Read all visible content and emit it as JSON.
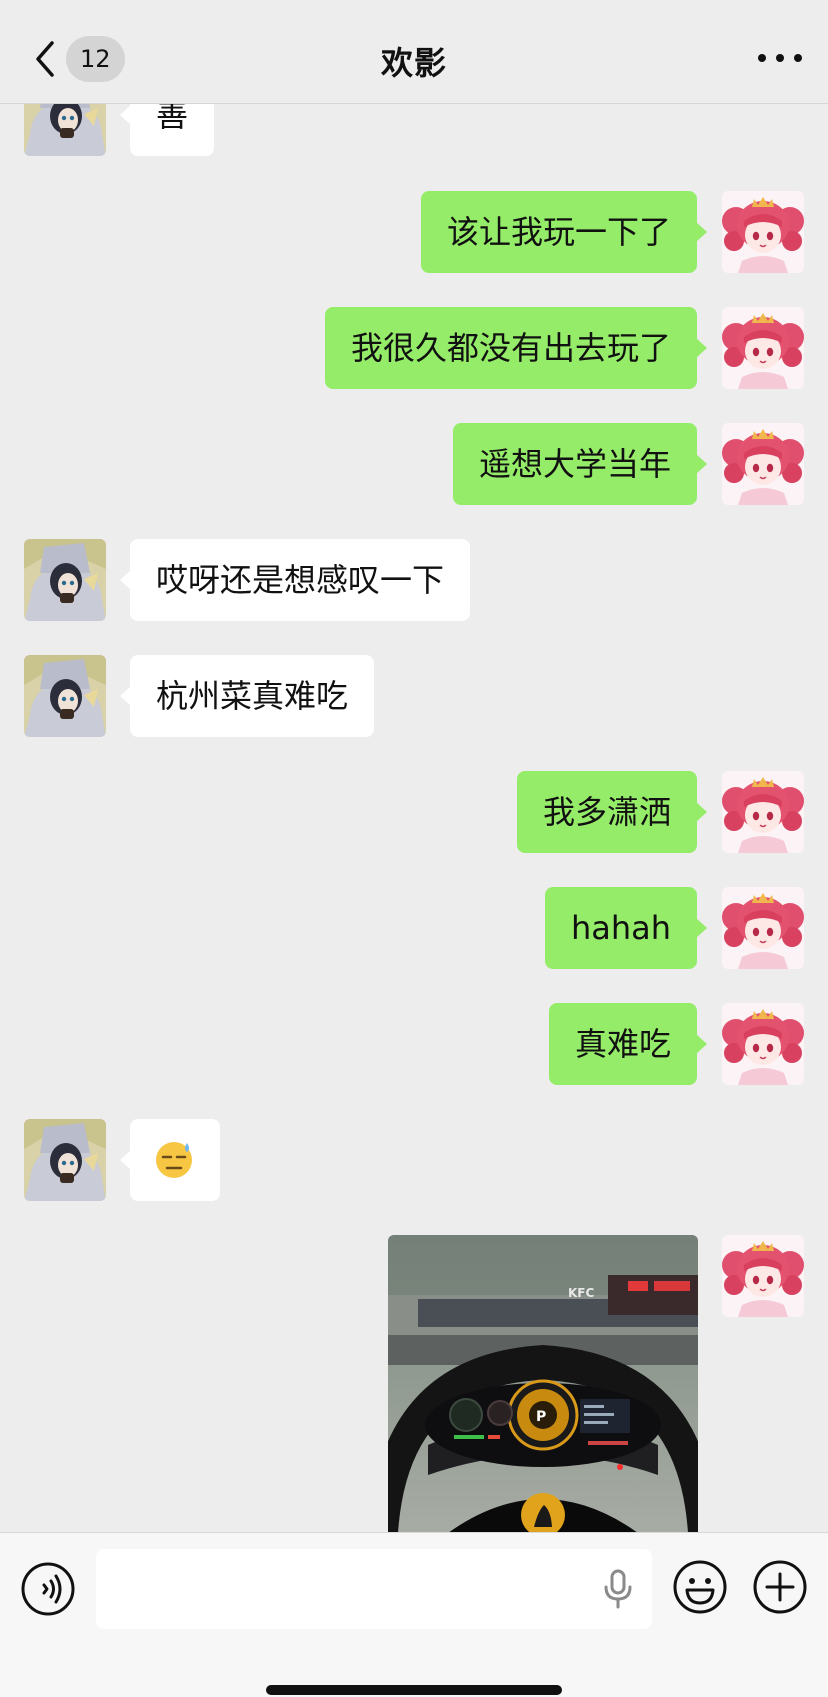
{
  "header": {
    "unread_count": "12",
    "title": "欢影"
  },
  "messages": [
    {
      "side": "in",
      "text": "善"
    },
    {
      "side": "out",
      "text": "该让我玩一下了"
    },
    {
      "side": "out",
      "text": "我很久都没有出去玩了"
    },
    {
      "side": "out",
      "text": "遥想大学当年"
    },
    {
      "side": "in",
      "text": "哎呀还是想感叹一下"
    },
    {
      "side": "in",
      "text": "杭州菜真难吃"
    },
    {
      "side": "out",
      "text": "我多潇洒"
    },
    {
      "side": "out",
      "text": "hahah"
    },
    {
      "side": "out",
      "text": "真难吃"
    },
    {
      "side": "in",
      "emoji": "sweat-smile-emoji"
    },
    {
      "side": "out",
      "image": "car-dashboard-photo",
      "sign_text": "KFC"
    }
  ],
  "colors": {
    "background": "#ededed",
    "outgoing_bubble": "#95ec69",
    "incoming_bubble": "#ffffff"
  },
  "icons": {
    "back": "chevron-left-icon",
    "more": "more-dots-icon",
    "voice": "voice-input-icon",
    "mic": "mic-icon",
    "emoji": "emoji-icon",
    "plus": "plus-icon"
  }
}
